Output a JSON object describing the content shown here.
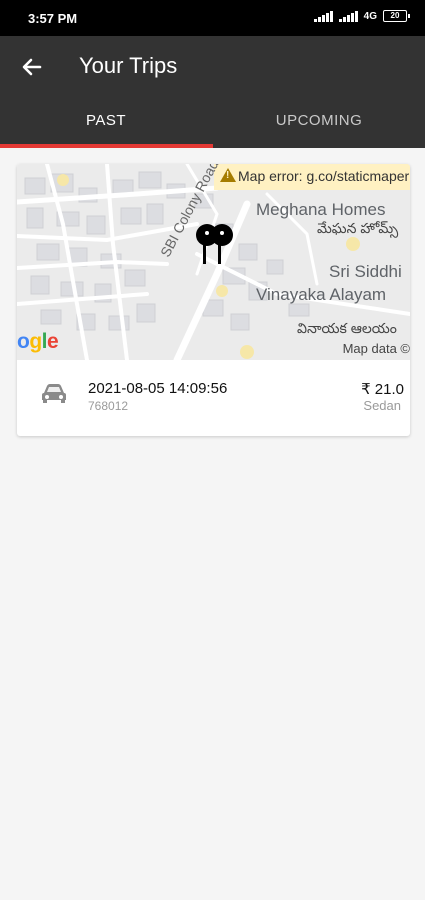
{
  "status_bar": {
    "time": "3:57 PM",
    "network": "4G",
    "battery": "20"
  },
  "header": {
    "title": "Your Trips"
  },
  "tabs": [
    {
      "label": "PAST",
      "active": true
    },
    {
      "label": "UPCOMING",
      "active": false
    }
  ],
  "colors": {
    "header_bg": "#333333",
    "tab_indicator": "#e53935",
    "status_bar_bg": "#000000"
  },
  "trips": [
    {
      "map": {
        "error_text": "Map error: g.co/staticmaperror",
        "labels": {
          "place1": "Meghana Homes",
          "place1_telugu": "మేఘన హోమ్స్",
          "place2_line1": "Sri Siddhi",
          "place2_line2": "Vinayaka Alayam",
          "place2_telugu": "వినాయక ఆలయం",
          "road": "SBI Colony Road"
        },
        "attribution": "Map data ©",
        "google_logo": "Google"
      },
      "datetime": "2021-08-05 14:09:56",
      "trip_id": "768012",
      "fare": "₹ 21.0",
      "vehicle_type": "Sedan",
      "vehicle_icon": "car-icon"
    }
  ]
}
